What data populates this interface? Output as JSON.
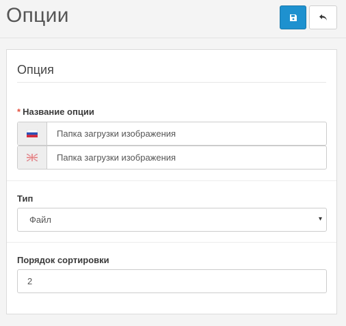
{
  "header": {
    "title": "Опции",
    "save_icon": "save-icon",
    "back_icon": "reply-icon",
    "save_color": "#1e91cf"
  },
  "panel": {
    "title": "Опция",
    "name_field": {
      "required_mark": "*",
      "label": "Название опции",
      "languages": [
        {
          "flag_icon": "russia-flag-icon",
          "value": "Папка загрузки изображения"
        },
        {
          "flag_icon": "uk-flag-icon",
          "value": "Папка загрузки изображения"
        }
      ]
    },
    "type_field": {
      "label": "Тип",
      "selected": "Файл",
      "arrow": "▾"
    },
    "sort_field": {
      "label": "Порядок сортировки",
      "value": "2"
    }
  }
}
